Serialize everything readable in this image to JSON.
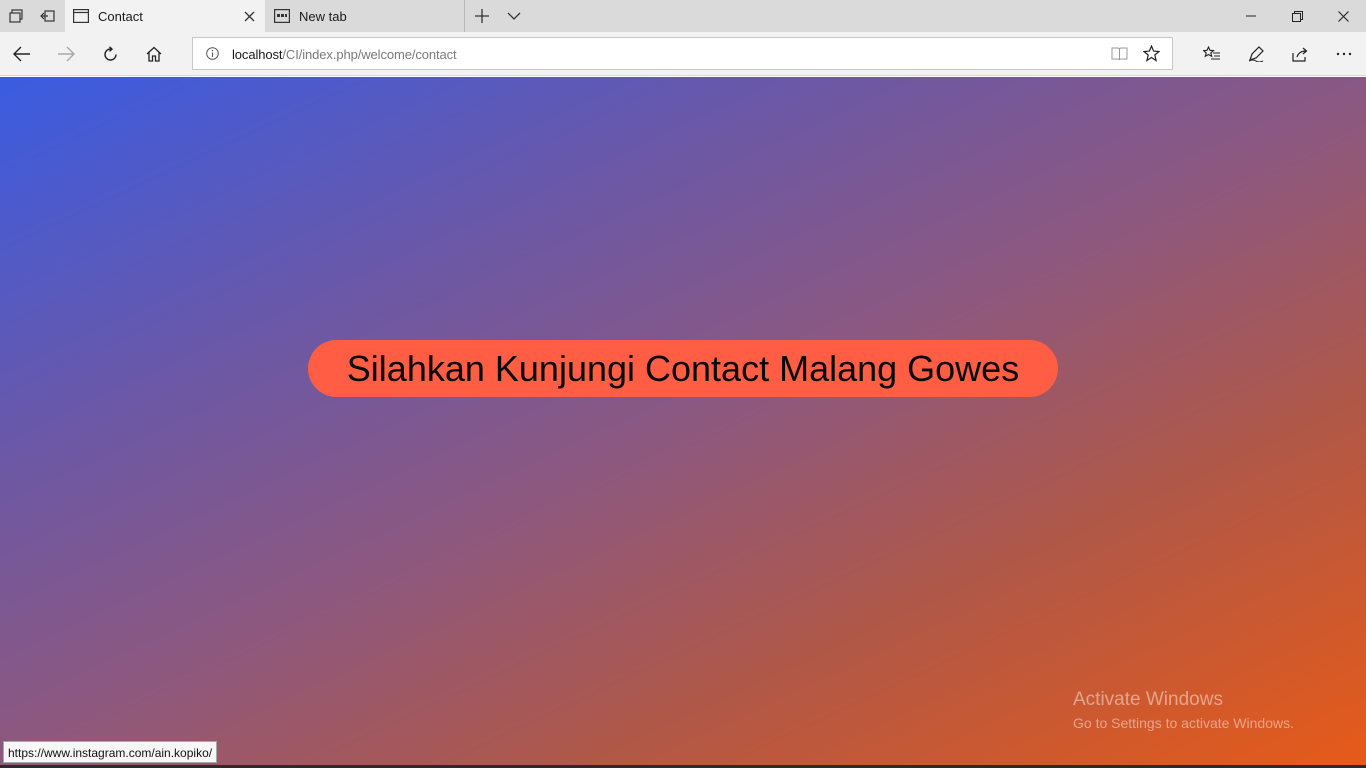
{
  "browser": {
    "tabs": [
      {
        "title": "Contact",
        "active": true
      },
      {
        "title": "New tab",
        "active": false
      }
    ],
    "address": {
      "host": "localhost",
      "path": "/CI/index.php/welcome/contact"
    },
    "status_url": "https://www.instagram.com/ain.kopiko/"
  },
  "page": {
    "heading": "Silahkan Kunjungi Contact Malang Gowes",
    "colors": {
      "gradient_start": "#3a5ce2",
      "gradient_end": "#e75a18",
      "pill": "#ff5e44"
    }
  },
  "watermark": {
    "title": "Activate Windows",
    "subtitle": "Go to Settings to activate Windows."
  }
}
